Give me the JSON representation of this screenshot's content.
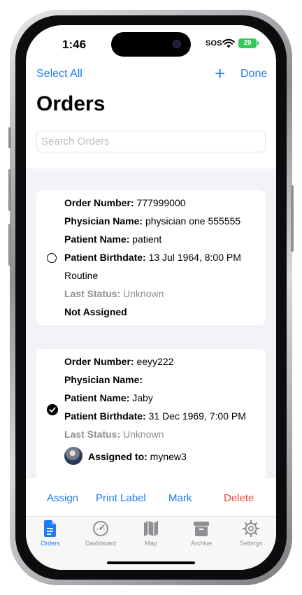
{
  "status": {
    "time": "1:46",
    "sos": "SOS",
    "battery": "29"
  },
  "nav": {
    "select_all": "Select All",
    "add_icon": "+",
    "done": "Done"
  },
  "title": "Orders",
  "search": {
    "placeholder": "Search Orders"
  },
  "orders": [
    {
      "order_number_label": "Order Number:",
      "order_number": "777999000",
      "physician_label": "Physician Name:",
      "physician": "physician one 555555",
      "patient_label": "Patient Name:",
      "patient": "patient",
      "birthdate_label": "Patient Birthdate:",
      "birthdate": "13 Jul 1964, 8:00 PM",
      "priority": "Routine",
      "last_status_label": "Last Status:",
      "last_status": "Unknown",
      "assignment": "Not Assigned",
      "selected": false
    },
    {
      "order_number_label": "Order Number:",
      "order_number": "eeyy222",
      "physician_label": "Physician Name:",
      "physician": "",
      "patient_label": "Patient Name:",
      "patient": "Jaby",
      "birthdate_label": "Patient Birthdate:",
      "birthdate": "31 Dec 1969, 7:00 PM",
      "last_status_label": "Last Status:",
      "last_status": "Unknown",
      "assigned_label": "Assigned to:",
      "assigned_to": "mynew3",
      "selected": true
    }
  ],
  "toolbar": {
    "assign": "Assign",
    "print_label": "Print Label",
    "mark": "Mark",
    "delete": "Delete"
  },
  "tabs": [
    {
      "label": "Orders",
      "icon": "document-icon",
      "active": true
    },
    {
      "label": "Dashboard",
      "icon": "gauge-icon",
      "active": false
    },
    {
      "label": "Map",
      "icon": "map-icon",
      "active": false
    },
    {
      "label": "Archive",
      "icon": "archive-icon",
      "active": false
    },
    {
      "label": "Settings",
      "icon": "gear-icon",
      "active": false
    }
  ],
  "colors": {
    "accent": "#1f7cf4",
    "destructive": "#e0493f",
    "list_background": "#f2f2f7",
    "battery": "#34c759"
  }
}
